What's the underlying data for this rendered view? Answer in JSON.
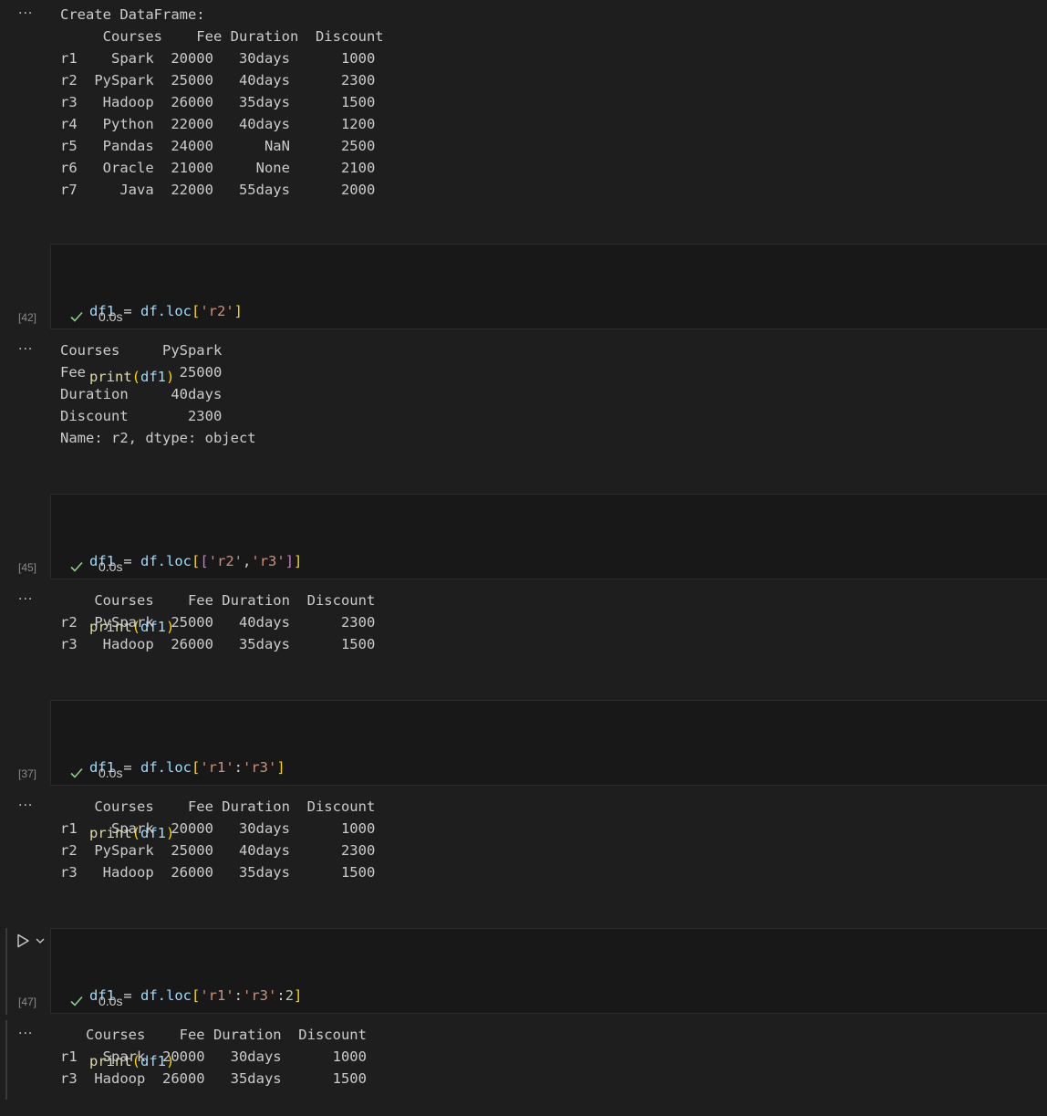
{
  "outputs": [
    {
      "more": "···",
      "text": "Create DataFrame:\n     Courses    Fee Duration  Discount\nr1    Spark  20000   30days      1000\nr2  PySpark  25000   40days      2300\nr3   Hadoop  26000   35days      1500\nr4   Python  22000   40days      1200\nr5   Pandas  24000      NaN      2500\nr6   Oracle  21000     None      2100\nr7     Java  22000   55days      2000"
    },
    {
      "more": "···",
      "text": "Courses     PySpark\nFee           25000\nDuration     40days\nDiscount       2300\nName: r2, dtype: object"
    },
    {
      "more": "···",
      "text": "    Courses    Fee Duration  Discount\nr2  PySpark  25000   40days      2300\nr3   Hadoop  26000   35days      1500"
    },
    {
      "more": "···",
      "text": "    Courses    Fee Duration  Discount\nr1    Spark  20000   30days      1000\nr2  PySpark  25000   40days      2300\nr3   Hadoop  26000   35days      1500"
    },
    {
      "more": "···",
      "text": "   Courses    Fee Duration  Discount\nr1   Spark  20000   30days      1000\nr3  Hadoop  26000   35days      1500"
    }
  ],
  "cells": [
    {
      "exec_count": "[42]",
      "time": "0.0s",
      "line1": {
        "var": "df1",
        "eq": " = ",
        "obj": "df.loc",
        "open": "[",
        "s1": "'r2'",
        "close": "]"
      },
      "line2": {
        "fn": "print",
        "open": "(",
        "arg": "df1",
        "close": ")"
      }
    },
    {
      "exec_count": "[45]",
      "time": "0.0s",
      "line1": {
        "var": "df1",
        "eq": " = ",
        "obj": "df.loc",
        "open": "[",
        "open2": "[",
        "s1": "'r2'",
        "comma": ",",
        "s2": "'r3'",
        "close2": "]",
        "close": "]"
      },
      "line2": {
        "fn": "print",
        "open": "(",
        "arg": "df1",
        "close": ")"
      }
    },
    {
      "exec_count": "[37]",
      "time": "0.0s",
      "line1": {
        "var": "df1",
        "eq": " = ",
        "obj": "df.loc",
        "open": "[",
        "s1": "'r1'",
        "colon": ":",
        "s2": "'r3'",
        "close": "]"
      },
      "line2": {
        "fn": "print",
        "open": "(",
        "arg": "df1",
        "close": ")"
      }
    },
    {
      "exec_count": "[47]",
      "time": "0.0s",
      "line1": {
        "var": "df1",
        "eq": " = ",
        "obj": "df.loc",
        "open": "[",
        "s1": "'r1'",
        "colon": ":",
        "s2": "'r3'",
        "colon2": ":",
        "num": "2",
        "close": "]"
      },
      "line2": {
        "fn": "print",
        "open": "(",
        "arg": "df1",
        "close": ")"
      }
    }
  ],
  "colors": {
    "background": "#1e1e1e",
    "cell_background": "#181818",
    "success_check": "#89d185",
    "string": "#ce9178",
    "variable": "#9cdcfe",
    "function": "#dcdcaa",
    "bracket_level1": "#ffd700",
    "bracket_level2": "#da70d6"
  },
  "icons": {
    "more": "ellipsis-icon",
    "status": "check-icon",
    "run": "play-icon",
    "run_menu": "chevron-down-icon"
  }
}
